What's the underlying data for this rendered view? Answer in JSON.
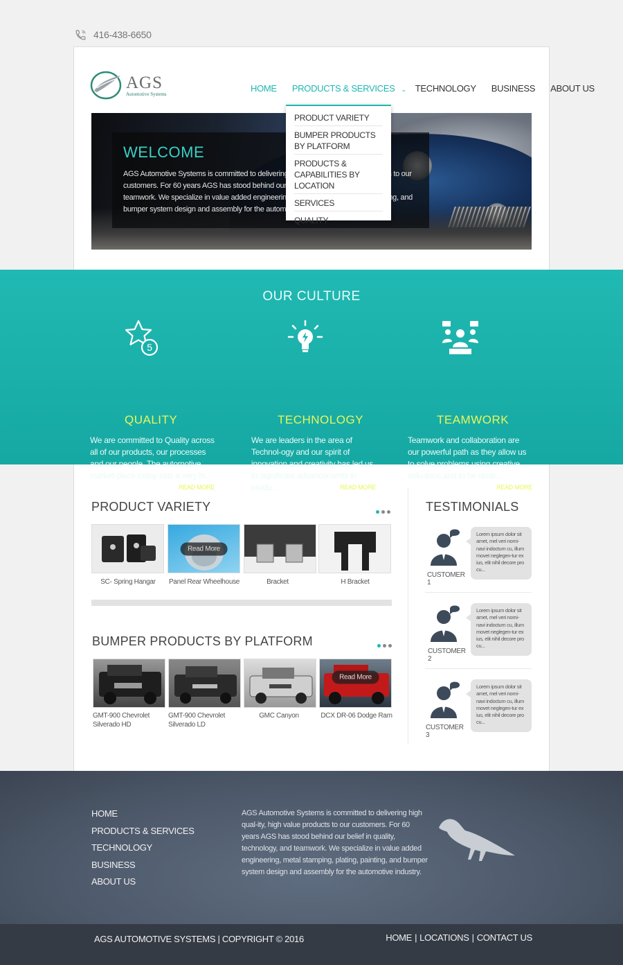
{
  "topbar": {
    "phone": "416-438-6650",
    "icon": "phone-icon"
  },
  "logo": {
    "name": "AGS",
    "tagline": "Automotive Systems"
  },
  "nav": {
    "home": "HOME",
    "products": "PRODUCTS & SERVICES",
    "technology": "TECHNOLOGY",
    "business": "BUSINESS",
    "about": "ABOUT US"
  },
  "dropdown": {
    "items": [
      "PRODUCT VARIETY",
      "BUMPER PRODUCTS BY PLATFORM",
      "PRODUCTS & CAPABILITIES BY LOCATION",
      "SERVICES",
      "QUALITY"
    ]
  },
  "hero": {
    "title": "WELCOME",
    "text": "AGS Automotive Systems is committed to delivering high quality, high value products to our customers. For 60 years AGS has stood behind our belief in quality, technology, and teamwork. We specialize in value added engineering, metal stamping, plating, painting, and bumper system design and assembly for the automotive industry."
  },
  "culture": {
    "title": "OUR CULTURE",
    "columns": [
      {
        "title": "QUALITY",
        "text": "We are committed to Quality across all of our products, our processes and our people. The automotive market-place today sets a very hi...",
        "more": "READ MORE",
        "icon": "star-five-icon"
      },
      {
        "title": "TECHNOLOGY",
        "text": "We are leaders in the area of Technol-ogy and our spirit of innovation and creativity has led us to significant advancements in produ...",
        "more": "READ MORE",
        "icon": "lightbulb-icon"
      },
      {
        "title": "TEAMWORK",
        "text": "Teamwork and collaboration are our powerful path as they allow us to solve problems using creative solu-tions and to be nimb...",
        "more": "READ MORE",
        "icon": "team-icon"
      }
    ]
  },
  "product_variety": {
    "title": "PRODUCT VARIETY",
    "read_more": "Read More",
    "items": [
      "SC- Spring Hangar",
      "Panel Rear Wheelhouse",
      "Bracket",
      "H Bracket"
    ]
  },
  "bumper": {
    "title": "BUMPER PRODUCTS BY PLATFORM",
    "read_more": "Read More",
    "items": [
      "GMT-900 Chevrolet Silverado HD",
      "GMT-900 Chevrolet Silverado LD",
      "GMC Canyon",
      "DCX DR-06 Dodge Ram"
    ]
  },
  "testimonials": {
    "title": "TESTIMONIALS",
    "items": [
      {
        "name": "CUSTOMER 1",
        "text": "Lorem ipsum dolor sit amet, mel veri nomi-navi indoctum cu, illum movet neglegen-tur ex ius, elit nihil decore pro cu..."
      },
      {
        "name": "CUSTOMER 2",
        "text": "Lorem ipsum dolor sit amet, mel veri nomi-navi indoctum cu, illum movet neglegen-tur ex ius, elit nihil decore pro cu..."
      },
      {
        "name": "CUSTOMER 3",
        "text": "Lorem ipsum dolor sit amet, mel veri nomi-navi indoctum cu, illum movet neglegen-tur ex ius, elit nihil decore pro cu..."
      }
    ]
  },
  "footer": {
    "links": [
      "HOME",
      "PRODUCTS & SERVICES",
      "TECHNOLOGY",
      "BUSINESS",
      "ABOUT US"
    ],
    "text": "AGS Automotive Systems is committed to delivering high qual-ity, high value products to our customers. For 60 years AGS has stood behind our belief in quality, technology, and teamwork. We specialize in value added engineering, metal stamping, plating, painting, and bumper system design and assembly for the automotive industry.",
    "copyright": "AGS AUTOMOTIVE SYSTEMS | COPYRIGHT © 2016",
    "bottom_links": {
      "home": "HOME",
      "locations": "LOCATIONS",
      "contact": "CONTACT US",
      "sep": "|"
    }
  },
  "colors": {
    "accent": "#1eb7b0",
    "highlight": "#e7f75a",
    "footer": "#4e5a6b",
    "bottom": "#353b45"
  }
}
